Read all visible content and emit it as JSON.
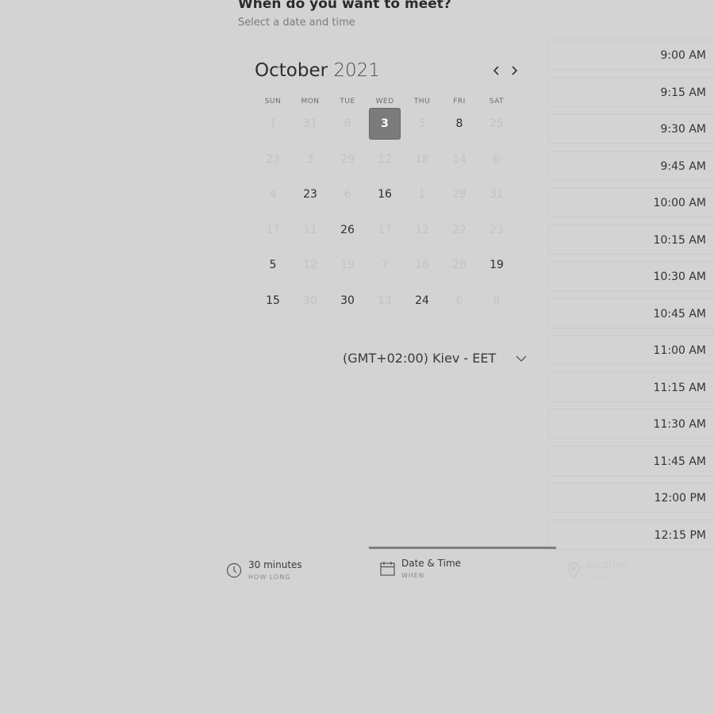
{
  "header": {
    "title": "When do you want to meet?",
    "subtitle": "Select a date and time"
  },
  "calendar": {
    "month": "October",
    "year": "2021",
    "prev_icon": "chevron-left-icon",
    "next_icon": "chevron-right-icon",
    "weekdays": [
      "SUN",
      "MON",
      "TUE",
      "WED",
      "THU",
      "FRI",
      "SAT"
    ],
    "weeks": [
      [
        {
          "d": "1",
          "s": "dis"
        },
        {
          "d": "31",
          "s": "dis"
        },
        {
          "d": "8",
          "s": "dis"
        },
        {
          "d": "3",
          "s": "sel"
        },
        {
          "d": "5",
          "s": "dis"
        },
        {
          "d": "8",
          "s": "avail"
        },
        {
          "d": "25",
          "s": "dis"
        }
      ],
      [
        {
          "d": "23",
          "s": "dis"
        },
        {
          "d": "3",
          "s": "dis"
        },
        {
          "d": "29",
          "s": "dis"
        },
        {
          "d": "12",
          "s": "dis"
        },
        {
          "d": "18",
          "s": "dis"
        },
        {
          "d": "14",
          "s": "dis"
        },
        {
          "d": "6",
          "s": "dis"
        }
      ],
      [
        {
          "d": "4",
          "s": "dis"
        },
        {
          "d": "23",
          "s": "avail"
        },
        {
          "d": "6",
          "s": "dis"
        },
        {
          "d": "16",
          "s": "avail"
        },
        {
          "d": "1",
          "s": "dis"
        },
        {
          "d": "28",
          "s": "dis"
        },
        {
          "d": "31",
          "s": "dis"
        }
      ],
      [
        {
          "d": "17",
          "s": "dis"
        },
        {
          "d": "11",
          "s": "dis"
        },
        {
          "d": "26",
          "s": "avail"
        },
        {
          "d": "17",
          "s": "dis"
        },
        {
          "d": "12",
          "s": "dis"
        },
        {
          "d": "22",
          "s": "dis"
        },
        {
          "d": "23",
          "s": "dis"
        }
      ],
      [
        {
          "d": "5",
          "s": "avail"
        },
        {
          "d": "12",
          "s": "dis"
        },
        {
          "d": "19",
          "s": "dis"
        },
        {
          "d": "7",
          "s": "dis"
        },
        {
          "d": "16",
          "s": "dis"
        },
        {
          "d": "28",
          "s": "dis"
        },
        {
          "d": "19",
          "s": "avail"
        }
      ],
      [
        {
          "d": "15",
          "s": "avail"
        },
        {
          "d": "30",
          "s": "dis"
        },
        {
          "d": "30",
          "s": "avail"
        },
        {
          "d": "13",
          "s": "dis"
        },
        {
          "d": "24",
          "s": "avail"
        },
        {
          "d": "6",
          "s": "dis"
        },
        {
          "d": "8",
          "s": "dis"
        }
      ]
    ]
  },
  "timezone": {
    "label": "(GMT+02:00) Kiev - EET",
    "icon": "chevron-down-icon"
  },
  "time_slots": [
    "9:00 AM",
    "9:15 AM",
    "9:30 AM",
    "9:45 AM",
    "10:00 AM",
    "10:15 AM",
    "10:30 AM",
    "10:45 AM",
    "11:00 AM",
    "11:15 AM",
    "11:30 AM",
    "11:45 AM",
    "12:00 PM",
    "12:15 PM"
  ],
  "steps": {
    "progress_step": "Date & Time",
    "duration": {
      "title": "30 minutes",
      "caption": "HOW LONG",
      "icon": "clock-icon"
    },
    "datetime": {
      "title": "Date & Time",
      "caption": "WHEN",
      "icon": "calendar-icon"
    },
    "location": {
      "title": "Location",
      "caption": "WHERE",
      "icon": "map-pin-icon"
    }
  },
  "colors": {
    "background": "#d3d3d3",
    "selected_day": "#7b7b7b",
    "progress": "#7e7e7e"
  }
}
